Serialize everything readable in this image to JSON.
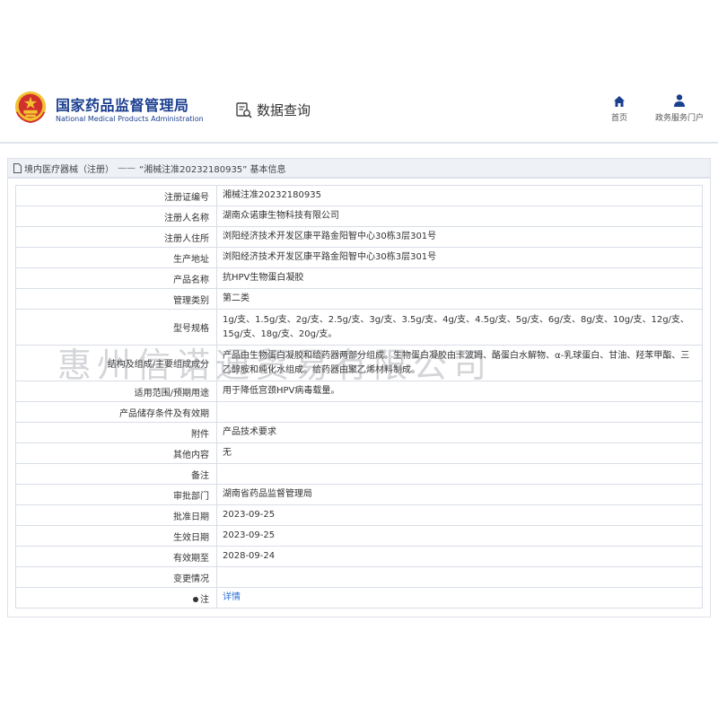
{
  "header": {
    "agency_cn": "国家药品监督管理局",
    "agency_en": "National Medical Products Administration",
    "query_label": "数据查询",
    "nav_home": "首页",
    "nav_service": "政务服务门户"
  },
  "breadcrumb": {
    "category": "境内医疗器械（注册）",
    "separator": "——",
    "title": "“湘械注准20232180935” 基本信息"
  },
  "rows": [
    {
      "label": "注册证编号",
      "value": "湘械注准20232180935"
    },
    {
      "label": "注册人名称",
      "value": "湖南众诺康生物科技有限公司"
    },
    {
      "label": "注册人住所",
      "value": "浏阳经济技术开发区康平路金阳智中心30栋3层301号"
    },
    {
      "label": "生产地址",
      "value": "浏阳经济技术开发区康平路金阳智中心30栋3层301号"
    },
    {
      "label": "产品名称",
      "value": "抗HPV生物蛋白凝胶"
    },
    {
      "label": "管理类别",
      "value": "第二类"
    },
    {
      "label": "型号规格",
      "value": "1g/支、1.5g/支、2g/支、2.5g/支、3g/支、3.5g/支、4g/支、4.5g/支、5g/支、6g/支、8g/支、10g/支、12g/支、15g/支、18g/支、20g/支。"
    },
    {
      "label": "结构及组成/主要组成成分",
      "value": "产品由生物蛋白凝胶和给药器两部分组成。生物蛋白凝胶由卡波姆、酪蛋白水解物、α-乳球蛋白、甘油、羟苯甲酯、三乙醇胺和纯化水组成。给药器由聚乙烯材料制成。"
    },
    {
      "label": "适用范围/预期用途",
      "value": "用于降低宫颈HPV病毒载量。"
    },
    {
      "label": "产品储存条件及有效期",
      "value": ""
    },
    {
      "label": "附件",
      "value": "产品技术要求"
    },
    {
      "label": "其他内容",
      "value": "无"
    },
    {
      "label": "备注",
      "value": ""
    },
    {
      "label": "审批部门",
      "value": "湖南省药品监督管理局"
    },
    {
      "label": "批准日期",
      "value": "2023-09-25"
    },
    {
      "label": "生效日期",
      "value": "2023-09-25"
    },
    {
      "label": "有效期至",
      "value": "2028-09-24"
    },
    {
      "label": "变更情况",
      "value": ""
    },
    {
      "label": "注",
      "value": "详情"
    }
  ],
  "watermark": "惠州信诺通贸易有限公司",
  "colors": {
    "brand_blue": "#1b3f8f",
    "link_blue": "#2a6fd6",
    "breadcrumb_bg": "#eef1f6",
    "emblem_red": "#d0312d",
    "emblem_gold": "#f2c230"
  }
}
